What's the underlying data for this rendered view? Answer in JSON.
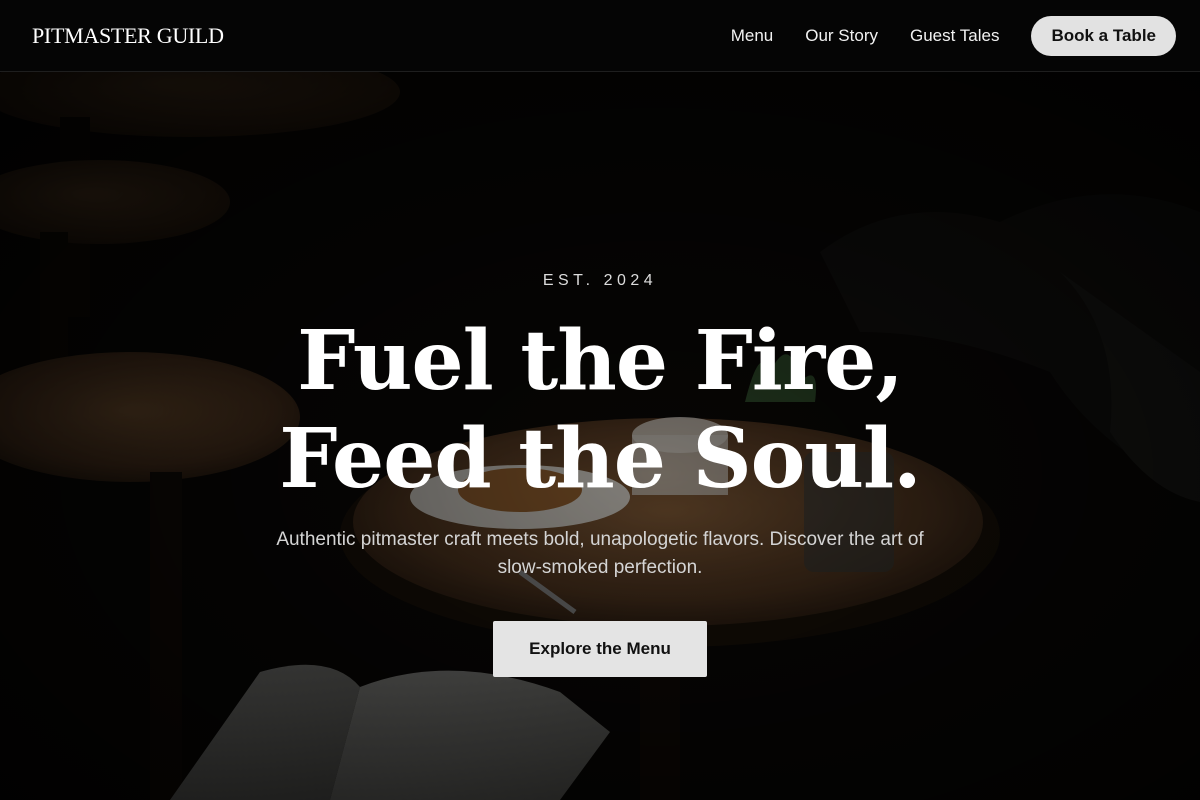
{
  "header": {
    "logo": "PITMASTER GUILD",
    "nav": [
      {
        "label": "Menu"
      },
      {
        "label": "Our Story"
      },
      {
        "label": "Guest Tales"
      }
    ],
    "book_label": "Book a Table"
  },
  "hero": {
    "eyebrow": "EST. 2024",
    "headline_line1": "Fuel the Fire,",
    "headline_line2": "Feed the Soul.",
    "subtext": "Authentic pitmaster craft meets bold, unapologetic flavors. Discover the art of slow-smoked perfection.",
    "cta_label": "Explore the Menu",
    "background_image": "dark restaurant interior with wooden tables, coffee cup, pastry plate, plant, and open book"
  },
  "colors": {
    "header_bg": "#050505",
    "button_bg": "#e2e2e2",
    "button_text": "#111111",
    "wood": "#6b4a2c"
  }
}
